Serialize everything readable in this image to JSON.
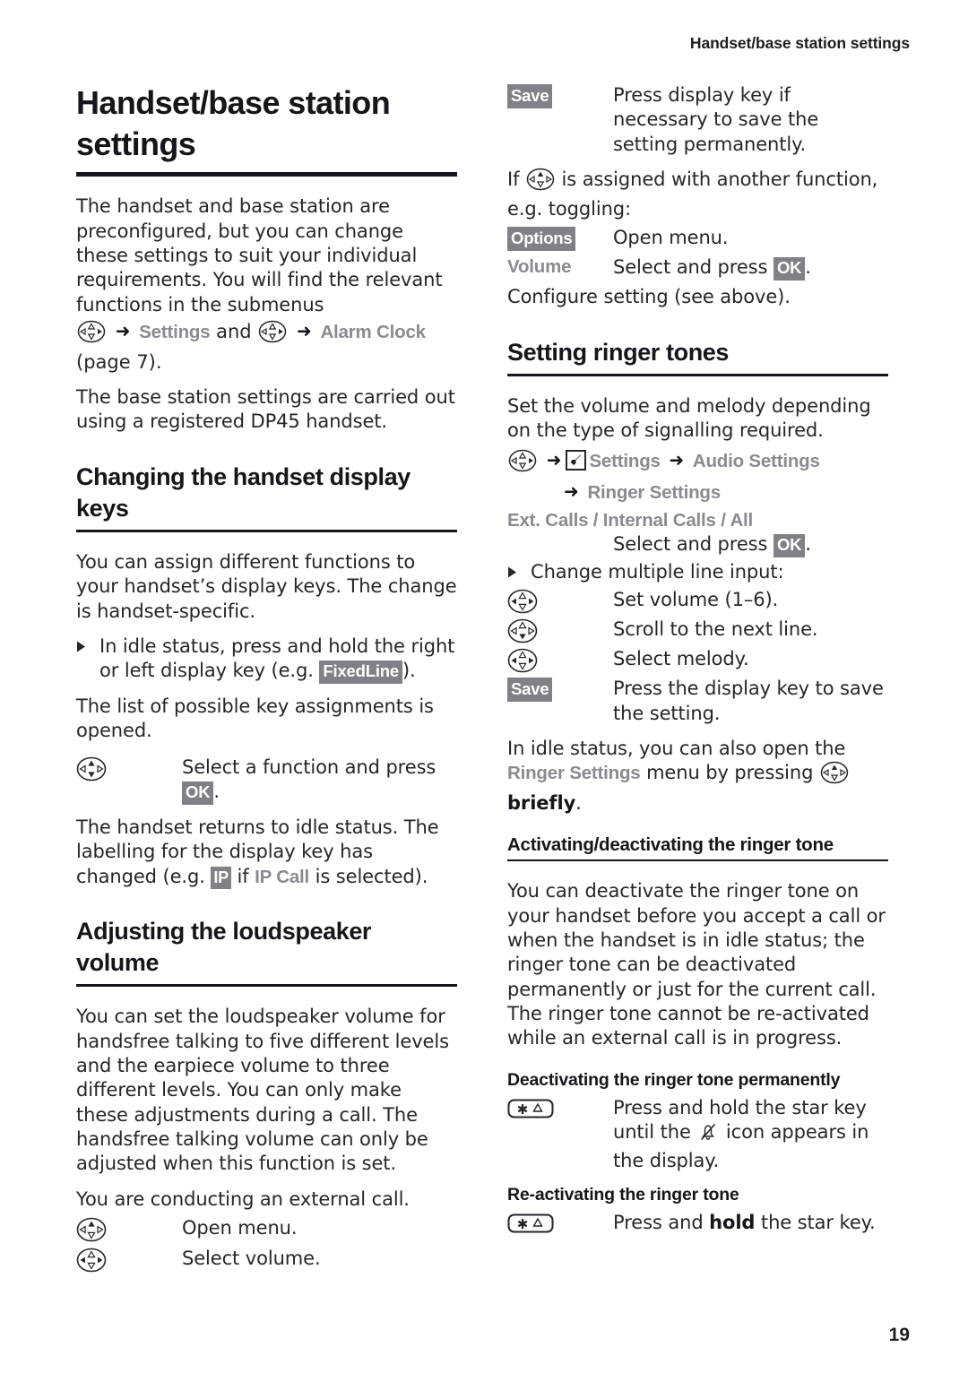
{
  "page": {
    "running_header": "Handset/base station settings",
    "folio": "19"
  },
  "colors": {
    "badge_bg": "#808087",
    "badge_text": "#ffffff",
    "menu_text": "#8a8a92",
    "body_text": "#25252c",
    "rule": "#15151b"
  },
  "left_column": {
    "chapter_title": "Handset/base station settings",
    "intro_p1": "The handset and base station are precon-figured, but you can change these settings to suit your individual require-ments. You will find the relevant functions in the submenus",
    "intro_p1_text": "The handset and base station are preconfigured, but you can change these settings to suit your individual requirements. You will find the relevant functions in the submenus",
    "menu_path": {
      "nav_icon_1": "nav-key-icon",
      "arrow": "➜",
      "item_1": "Settings",
      "conjunction": "and",
      "nav_icon_2": "nav-key-icon",
      "item_2": "Alarm Clock",
      "page_ref": "(page 7)."
    },
    "intro_p2": "The base station settings are carried out using a registered DP45 handset.",
    "section_display_keys": {
      "heading": "Changing the handset display keys",
      "p1": "You can assign different functions to your handset’s display keys. The change is handset-specific.",
      "bullet_1_pre": "In idle status, press and hold the right or left display key (e.g. ",
      "bullet_1_badge": "FixedLine",
      "bullet_1_post": ").",
      "p2": "The list of possible key assignments is opened.",
      "row_select_pre": "Select a function and press ",
      "row_select_badge": "OK",
      "row_select_post": ".",
      "p3_pre": "The handset returns to idle status. The labelling for the display key has changed (e.g. ",
      "p3_badge": "IP",
      "p3_mid": " if ",
      "p3_menu": "IP Call",
      "p3_post": " is selected)."
    },
    "section_loudspeaker": {
      "heading": "Adjusting the loudspeaker volume",
      "p1": "You can set the loudspeaker volume for handsfree talking to five different levels and the earpiece volume to three different levels. You can only make these adjustments during a call. The handsfree talking volume can only be adjusted when this function is set.",
      "p2": "You are conducting an external call.",
      "row_open_menu": "Open menu.",
      "row_select_volume": "Select volume."
    }
  },
  "right_column": {
    "row_save_badge": "Save",
    "row_save_text": "Press display key if necessary to save the setting perma-nently.",
    "row_save_text_plain": "Press display key if necessary to save the setting permanently.",
    "if_assigned_pre": "If ",
    "if_assigned_post": " is assigned with another function, e.g. toggling:",
    "row_options_badge": "Options",
    "row_options_text": "Open menu.",
    "row_volume_menu": "Volume",
    "row_volume_text_pre": "Select and press ",
    "row_volume_badge": "OK",
    "row_volume_text_post": ".",
    "configure_setting": "Configure setting (see above).",
    "section_ringer_tones": {
      "heading": "Setting ringer tones",
      "p1": "Set the volume and melody depending on the type of signalling required.",
      "path_item_1": "Settings",
      "path_item_2": "Audio Settings",
      "path_item_3": "Ringer Settings",
      "options_line": "Ext. Calls / Internal Calls / All",
      "options_select_pre": "Select and press ",
      "options_select_badge": "OK",
      "options_select_post": ".",
      "bullet_change": "Change multiple line input:",
      "row_set_volume": "Set volume (1–6).",
      "row_scroll": "Scroll to the next line.",
      "row_select_melody": "Select melody.",
      "row_save_badge": "Save",
      "row_save_text": "Press the display key to save the setting.",
      "idle_pre": "In idle status, you can also open the ",
      "idle_menu_1": "Ringer Settings",
      "idle_mid": " menu by pressing ",
      "idle_bold": "briefly",
      "idle_post": "."
    },
    "section_activating": {
      "heading": "Activating/deactivating the ringer tone",
      "p1": "You can deactivate the ringer tone on your handset before you accept a call or when the handset is in idle status; the ringer tone can be deactivated permanently or just for the current call. The ringer tone cannot be re-activated while an external call is in progress.",
      "sub_deactivating": "Deactivating the ringer tone permanently",
      "row_deact_pre": "Press and hold the star key until the ",
      "row_deact_post": " icon appears in the display.",
      "sub_reactivating": "Re-activating the ringer tone",
      "row_react_pre": "Press and ",
      "row_react_bold": "hold",
      "row_react_post": " the star key."
    }
  },
  "icons": {
    "nav_key": "nav-key-icon",
    "star_key": "star-key-icon",
    "settings_box": "settings-box-icon",
    "bell_slash": "bell-slash-icon",
    "triangle_bullet": "triangle-bullet-icon",
    "arrow_right": "arrow-right-icon"
  }
}
